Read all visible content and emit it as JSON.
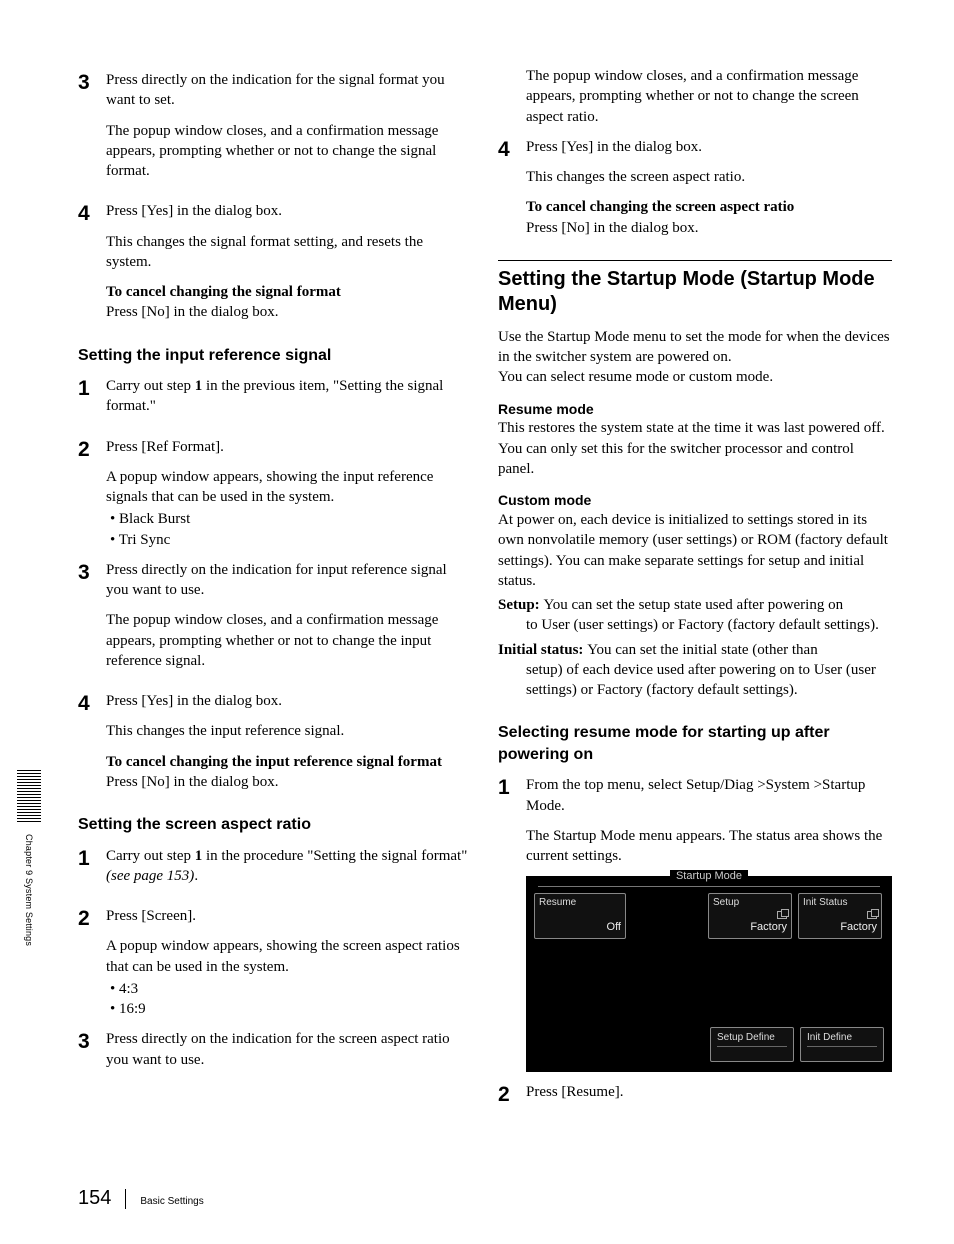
{
  "sideTab": "Chapter 9  System Settings",
  "pageNumber": "154",
  "footerSection": "Basic Settings",
  "left": {
    "s3": {
      "p1": "Press directly on the indication for the signal format you want to set.",
      "p2": "The popup window closes, and a confirmation message appears, prompting whether or not to change the signal format."
    },
    "s4": {
      "p1": "Press [Yes] in the dialog box.",
      "p2": "This changes the signal format setting, and resets the system.",
      "sub_label": "To cancel changing the signal format",
      "sub_body": "Press [No] in the dialog box."
    },
    "h_input": "Setting the input reference signal",
    "i1": {
      "a": "Carry out step ",
      "b": "1",
      "c": " in the previous item, \"Setting the signal format.\""
    },
    "i2": {
      "p1": "Press [Ref Format].",
      "p2": "A popup window appears, showing the input reference signals that can be used in the system.",
      "b1": "Black Burst",
      "b2": "Tri Sync"
    },
    "i3": {
      "p1": "Press directly on the indication for input reference signal you want to use.",
      "p2": "The popup window closes, and a confirmation message appears, prompting whether or not to change the input reference signal."
    },
    "i4": {
      "p1": "Press [Yes] in the dialog box.",
      "p2": "This changes the input reference signal.",
      "sub_label": "To cancel changing the input reference signal format",
      "sub_body": "Press [No] in the dialog box."
    },
    "h_aspect": "Setting the screen aspect ratio",
    "a1": {
      "a": "Carry out step ",
      "b": "1",
      "c": " in the procedure \"Setting the signal format\" ",
      "d": "(see page 153)",
      "e": "."
    },
    "a2": {
      "p1": "Press [Screen].",
      "p2": "A popup window appears, showing the screen aspect ratios that can be used in the system.",
      "b1": "4:3",
      "b2": "16:9"
    },
    "a3": {
      "p1": "Press directly on the indication for the screen aspect ratio you want to use."
    }
  },
  "right": {
    "cont": "The popup window closes, and a confirmation message appears, prompting whether or not to change the screen aspect ratio.",
    "s4": {
      "p1": "Press [Yes] in the dialog box.",
      "p2": "This changes the screen aspect ratio.",
      "sub_label": "To cancel changing the screen aspect ratio",
      "sub_body": "Press [No] in the dialog box."
    },
    "h2": "Setting the Startup Mode (Startup Mode Menu)",
    "intro1": "Use the Startup Mode menu to set the mode for when the devices in the switcher system are powered on.",
    "intro2": "You can select resume mode or custom mode.",
    "resume_h": "Resume mode",
    "resume_p": "This restores the system state at the time it was last powered off. You can only set this for the switcher processor and control panel.",
    "custom_h": "Custom mode",
    "custom_p": "At power on, each device is initialized to settings stored in its own nonvolatile memory (user settings) or ROM (factory default settings). You can make separate settings for setup and initial status.",
    "d1_term": "Setup: ",
    "d1_first": "You can set the setup state used after powering on",
    "d1_rest": "to User (user settings) or Factory (factory default settings).",
    "d2_term": "Initial status: ",
    "d2_first": "You can set the initial state (other than",
    "d2_rest": "setup) of each device used after powering on to User (user settings) or Factory (factory default settings).",
    "h_select": "Selecting resume mode for starting up after powering on",
    "r1": {
      "p1": "From the top menu, select Setup/Diag >System >Startup Mode.",
      "p2": "The Startup Mode menu appears. The status area shows the current settings."
    },
    "r2": "Press [Resume].",
    "ui": {
      "title": "Startup Mode",
      "resume": "Resume",
      "resume_val": "Off",
      "setup": "Setup",
      "setup_val": "Factory",
      "init": "Init Status",
      "init_val": "Factory",
      "btn1": "Setup Define",
      "btn2": "Init Define"
    }
  }
}
